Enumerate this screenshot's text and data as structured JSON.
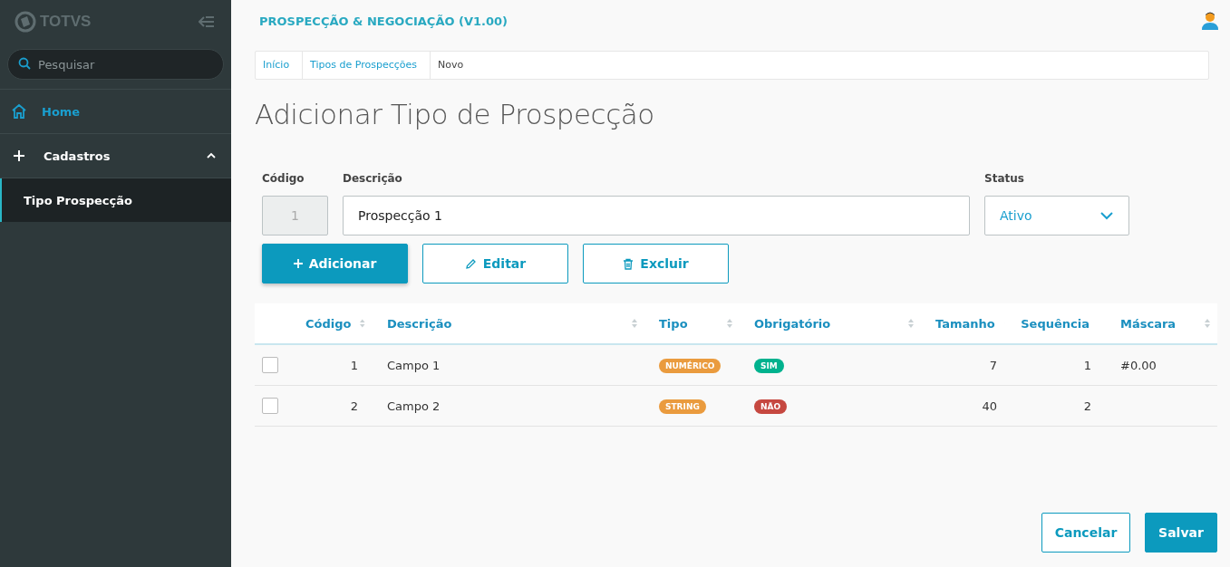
{
  "sidebar": {
    "logo": "TOTVS",
    "search": {
      "placeholder": "Pesquisar"
    },
    "items": [
      {
        "label": "Home",
        "kind": "link",
        "selected": false
      },
      {
        "label": "Cadastros",
        "kind": "group",
        "expanded": true,
        "children": [
          {
            "label": "Tipo Prospecção",
            "selected": true
          }
        ]
      }
    ]
  },
  "header": {
    "title": "PROSPECÇÃO & NEGOCIAÇÃO (V1.00)"
  },
  "breadcrumb": [
    "Início",
    "Tipos de Prospecções",
    "Novo"
  ],
  "page_title": "Adicionar Tipo de Prospecção",
  "form": {
    "codigo": {
      "label": "Código",
      "value": "1",
      "disabled": true
    },
    "descricao": {
      "label": "Descrição",
      "value": "Prospecção 1"
    },
    "status": {
      "label": "Status",
      "value": "Ativo"
    }
  },
  "actions": [
    {
      "label": "Adicionar",
      "kind": "add",
      "primary": true
    },
    {
      "label": "Editar",
      "kind": "edit",
      "primary": false
    },
    {
      "label": "Excluir",
      "kind": "delete",
      "primary": false
    }
  ],
  "table": {
    "columns": [
      "Código",
      "Descrição",
      "Tipo",
      "Obrigatório",
      "Tamanho",
      "Sequência",
      "Máscara"
    ],
    "rows": [
      {
        "checked": false,
        "codigo": "1",
        "descricao": "Campo 1",
        "tipo": {
          "label": "NUMÉRICO",
          "color": "#ea9b3e"
        },
        "obrigatorio": {
          "label": "SIM",
          "color": "#00b28e"
        },
        "tamanho": "7",
        "sequencia": "1",
        "mascara": "#0.00"
      },
      {
        "checked": false,
        "codigo": "2",
        "descricao": "Campo 2",
        "tipo": {
          "label": "STRING",
          "color": "#ea9b3e"
        },
        "obrigatorio": {
          "label": "NÃO",
          "color": "#c64840"
        },
        "tamanho": "40",
        "sequencia": "2"
      }
    ]
  },
  "footer": [
    {
      "label": "Cancelar",
      "primary": false
    },
    {
      "label": "Salvar",
      "primary": true
    }
  ]
}
